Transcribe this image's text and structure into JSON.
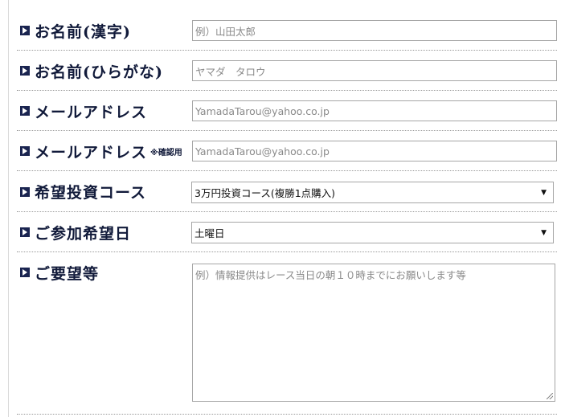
{
  "form": {
    "name_kanji": {
      "label": "お名前(漢字)",
      "placeholder": "例）山田太郎"
    },
    "name_kana": {
      "label": "お名前(ひらがな)",
      "placeholder": "ヤマダ　タロウ"
    },
    "email": {
      "label": "メールアドレス",
      "placeholder": "YamadaTarou@yahoo.co.jp"
    },
    "email_confirm": {
      "label": "メールアドレス",
      "note": "※確認用",
      "placeholder": "YamadaTarou@yahoo.co.jp"
    },
    "course": {
      "label": "希望投資コース",
      "selected": "3万円投資コース(複勝1点購入)"
    },
    "date": {
      "label": "ご参加希望日",
      "selected": "土曜日"
    },
    "request": {
      "label": "ご要望等",
      "placeholder": "例）情報提供はレース当日の朝１０時までにお願いします等"
    }
  }
}
